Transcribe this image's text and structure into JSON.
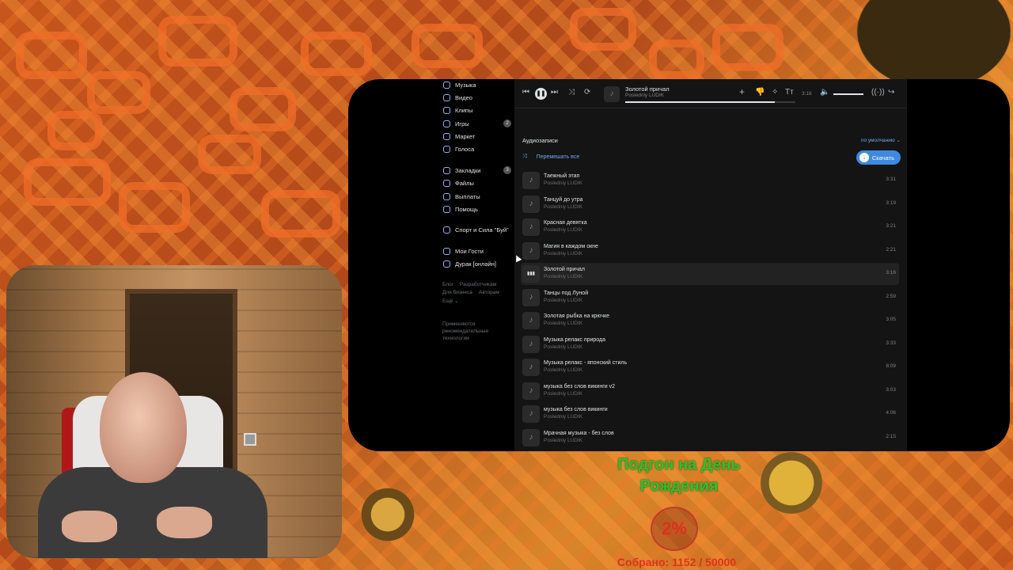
{
  "nav": {
    "items": [
      {
        "label": "Музыка",
        "icon": "music-icon"
      },
      {
        "label": "Видео",
        "icon": "video-icon"
      },
      {
        "label": "Клипы",
        "icon": "clips-icon"
      },
      {
        "label": "Игры",
        "icon": "games-icon",
        "badge": "2"
      },
      {
        "label": "Маркет",
        "icon": "market-icon"
      },
      {
        "label": "Голоса",
        "icon": "voices-icon"
      },
      {
        "label": "Закладки",
        "icon": "bookmark-icon",
        "badge": "3"
      },
      {
        "label": "Файлы",
        "icon": "files-icon"
      },
      {
        "label": "Выплаты",
        "icon": "payments-icon"
      },
      {
        "label": "Помощь",
        "icon": "help-icon"
      },
      {
        "label": "Спорт и Сила \"Буй\"",
        "icon": "community-icon"
      },
      {
        "label": "Мои Гости",
        "icon": "app-icon"
      },
      {
        "label": "Дурак [онлайн]",
        "icon": "game-icon"
      }
    ],
    "footer": {
      "blog": "Блог",
      "developers": "Разработчикам",
      "business": "Для бизнеса",
      "authors": "Авторам",
      "more": "Ещё ⌄",
      "recommend": "Применяются рекомендательные технологии"
    }
  },
  "player": {
    "title": "Золотой причал",
    "artist": "Posledniy LUDIK",
    "time": "3:16",
    "progress": 0.88,
    "volume": 0.85
  },
  "audio": {
    "section_title": "Аудиозаписи",
    "sort_label": "по умолчанию ⌄",
    "shuffle_label": "Перемешать все",
    "download_label": "Скачать",
    "tracks": [
      {
        "title": "Таежный этап",
        "artist": "Posledniy LUDIK",
        "duration": "3:31"
      },
      {
        "title": "Танцуй до утра",
        "artist": "Posledniy LUDIK",
        "duration": "3:19"
      },
      {
        "title": "Красная девятка",
        "artist": "Posledniy LUDIK",
        "duration": "3:21"
      },
      {
        "title": "Магия в каждом окне",
        "artist": "Posledniy LUDIK",
        "duration": "2:21"
      },
      {
        "title": "Золотой причал",
        "artist": "Posledniy LUDIK",
        "duration": "3:16",
        "active": true
      },
      {
        "title": "Танцы под Луной",
        "artist": "Posledniy LUDIK",
        "duration": "2:59"
      },
      {
        "title": "Золотая рыбка на крючке",
        "artist": "Posledniy LUDIK",
        "duration": "3:05"
      },
      {
        "title": "Музыка релакс природа",
        "artist": "Posledniy LUDIK",
        "duration": "3:33"
      },
      {
        "title": "Музыка релакс - японский стиль",
        "artist": "Posledniy LUDIK",
        "duration": "8:09"
      },
      {
        "title": "музыка без слов викинги v2",
        "artist": "Posledniy LUDIK",
        "duration": "3:03"
      },
      {
        "title": "музыка без слов викинги",
        "artist": "Posledniy LUDIK",
        "duration": "4:06"
      },
      {
        "title": "Мрачная музыка - без слов",
        "artist": "Posledniy LUDIK",
        "duration": "2:15"
      }
    ]
  },
  "overlay": {
    "goal_title": "Подгон на День Рождения",
    "goal_percent": "2%",
    "goal_progress": 0.02,
    "goal_sum": "Собрано: 1152 / 50000"
  },
  "colors": {
    "accent": "#3f8ae0",
    "link": "#71aaeb",
    "goal_green": "#2fbf2f",
    "goal_red": "#e0301e"
  }
}
